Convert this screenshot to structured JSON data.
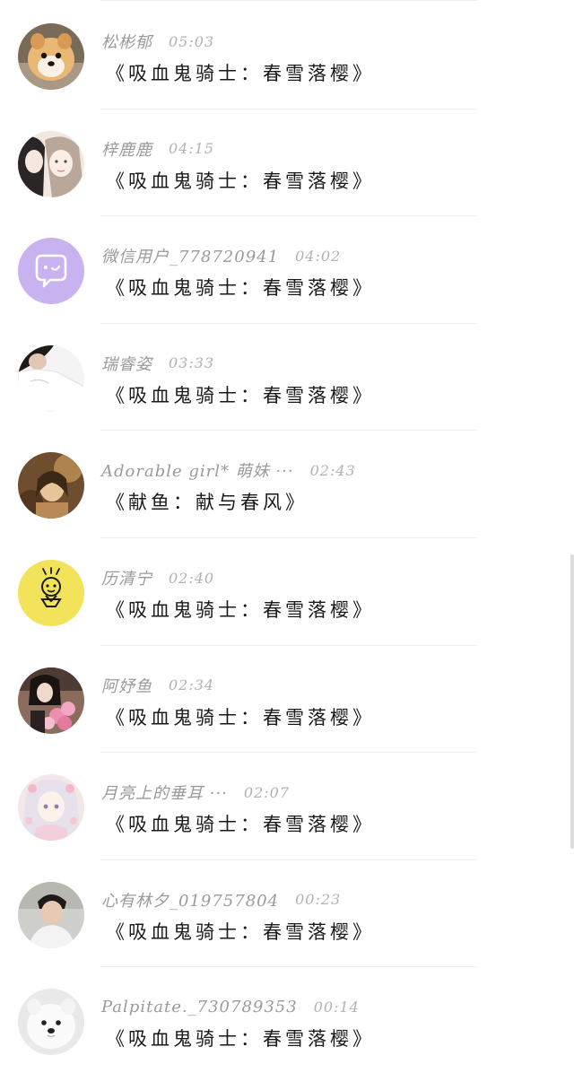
{
  "comments": [
    {
      "name": "松彬郁",
      "time": "05:03",
      "message": "《吸血鬼骑士：春雪落樱》",
      "avatar": "pomeranian-dog-avatar"
    },
    {
      "name": "梓鹿鹿",
      "time": "04:15",
      "message": "《吸血鬼骑士：春雪落樱》",
      "avatar": "anime-couple-avatar"
    },
    {
      "name": "微信用户_778720941",
      "time": "04:02",
      "message": "《吸血鬼骑士：春雪落樱》",
      "avatar": "default-wechat-avatar",
      "accent": "#c8b3f0"
    },
    {
      "name": "瑞睿姿",
      "time": "03:33",
      "message": "《吸血鬼骑士：春雪落樱》",
      "avatar": "girl-white-shirt-avatar"
    },
    {
      "name": "Adorable girl* 萌妹 ···",
      "time": "02:43",
      "message": "《献鱼：献与春风》",
      "avatar": "vintage-portrait-avatar"
    },
    {
      "name": "历清宁",
      "time": "02:40",
      "message": "《吸血鬼骑士：春雪落樱》",
      "avatar": "cartoon-face-avatar",
      "accent": "#f2e35a"
    },
    {
      "name": "阿妤鱼",
      "time": "02:34",
      "message": "《吸血鬼骑士：春雪落樱》",
      "avatar": "girl-flowers-avatar"
    },
    {
      "name": "月亮上的垂耳 ···",
      "time": "02:07",
      "message": "《吸血鬼骑士：春雪落樱》",
      "avatar": "anime-girl-pastel-avatar"
    },
    {
      "name": "心有林夕_019757804",
      "time": "00:23",
      "message": "《吸血鬼骑士：春雪落樱》",
      "avatar": "boy-portrait-avatar"
    },
    {
      "name": "Palpitate._730789353",
      "time": "00:14",
      "message": "《吸血鬼骑士：春雪落樱》",
      "avatar": "samoyed-dog-avatar"
    }
  ]
}
